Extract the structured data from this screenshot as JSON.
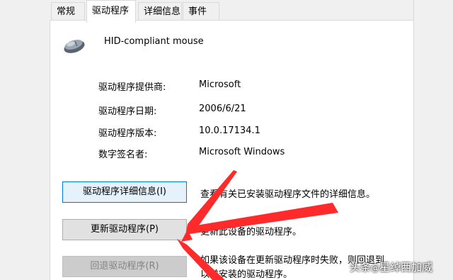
{
  "tabs": [
    {
      "label": "常规",
      "active": false
    },
    {
      "label": "驱动程序",
      "active": true
    },
    {
      "label": "详细信息",
      "active": false
    },
    {
      "label": "事件",
      "active": false
    }
  ],
  "device": {
    "name": "HID-compliant mouse",
    "icon": "mouse-icon"
  },
  "properties": [
    {
      "label": "驱动程序提供商:",
      "value": "Microsoft"
    },
    {
      "label": "驱动程序日期:",
      "value": "2006/6/21"
    },
    {
      "label": "驱动程序版本:",
      "value": "10.0.17134.1"
    },
    {
      "label": "数字签名者:",
      "value": "Microsoft Windows"
    }
  ],
  "buttons": {
    "details": {
      "label": "驱动程序详细信息(I)",
      "description": "查看有关已安装驱动程序文件的详细信息。"
    },
    "update": {
      "label": "更新驱动程序(P)",
      "description": "更新此设备的驱动程序。"
    },
    "rollback": {
      "label": "回退驱动程序(R)",
      "description_line1": "如果该设备在更新驱动程序时失败，则回退到",
      "description_line2": "以前安装的驱动程序。"
    }
  },
  "watermark": {
    "text1": "头条",
    "at": "@",
    "text2": "星绰西加威"
  },
  "colors": {
    "arrow": "#ff2a2a",
    "focus_border": "#0078d7",
    "focus_fill": "#e5f1fb"
  }
}
